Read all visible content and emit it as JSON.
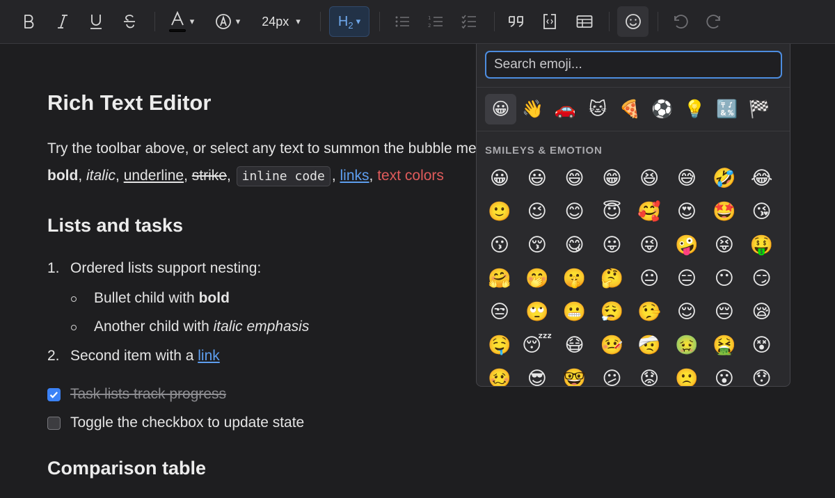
{
  "toolbar": {
    "font_size": "24px",
    "heading_label": "H",
    "heading_sub": "2",
    "buttons": [
      "bold",
      "italic",
      "underline",
      "strikethrough",
      "text-color",
      "highlight",
      "font-size",
      "heading",
      "bullet-list",
      "ordered-list",
      "task-list",
      "blockquote",
      "code-block",
      "table",
      "emoji",
      "undo",
      "redo"
    ]
  },
  "doc": {
    "title": "Rich Text Editor",
    "intro": "Try the toolbar above, or select any text to summon the bubble menu. Supports",
    "formats": {
      "bold": "bold",
      "italic": "italic",
      "underline": "underline",
      "strike": "strike",
      "code": "inline code",
      "link": "links",
      "colors": "text colors"
    },
    "lists_heading": "Lists and tasks",
    "ordered": [
      {
        "marker": "1.",
        "text": "Ordered lists support nesting:"
      },
      {
        "marker": "2.",
        "text": "Second item with a ",
        "link": "link"
      }
    ],
    "bullets": [
      {
        "text": "Bullet child with ",
        "strong": "bold"
      },
      {
        "text": "Another child with ",
        "em": "italic emphasis"
      }
    ],
    "tasks": [
      {
        "text": "Task lists track progress",
        "checked": true
      },
      {
        "text": "Toggle the checkbox to update state",
        "checked": false
      }
    ],
    "table_heading": "Comparison table"
  },
  "emoji_picker": {
    "search_placeholder": "Search emoji...",
    "categories": [
      "😀",
      "👋",
      "🚗",
      "🐱",
      "🍕",
      "⚽",
      "💡",
      "🔣",
      "🏁"
    ],
    "section_title": "SMILEYS & EMOTION",
    "emojis": [
      [
        "😀",
        "😃",
        "😄",
        "😁",
        "😆",
        "😅",
        "🤣",
        "😂"
      ],
      [
        "🙂",
        "😉",
        "😊",
        "😇",
        "🥰",
        "😍",
        "🤩",
        "😘"
      ],
      [
        "😗",
        "😚",
        "😋",
        "😛",
        "😜",
        "🤪",
        "😝",
        "🤑"
      ],
      [
        "🤗",
        "🤭",
        "🤫",
        "🤔",
        "😐",
        "😑",
        "😶",
        "😏"
      ],
      [
        "😒",
        "🙄",
        "😬",
        "😮‍💨",
        "🤥",
        "😌",
        "😔",
        "😪"
      ],
      [
        "🤤",
        "😴",
        "😷",
        "🤒",
        "🤕",
        "🤢",
        "🤮",
        "😵"
      ],
      [
        "🥴",
        "😎",
        "🤓",
        "😕",
        "😟",
        "🙁",
        "😮",
        "😯"
      ]
    ]
  },
  "colors": {
    "accent": "#4d8de0",
    "link": "#5e9ff0",
    "red_text": "#e05b5b",
    "check": "#3b82f6"
  }
}
